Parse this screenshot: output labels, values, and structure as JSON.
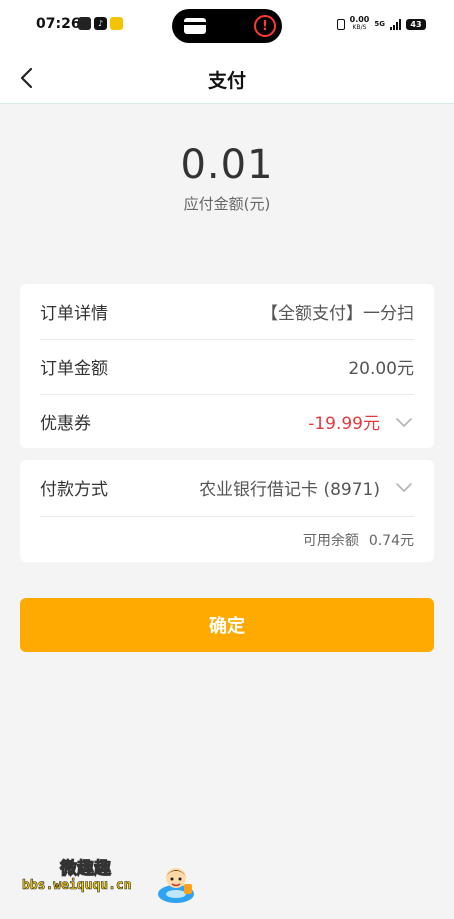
{
  "status_bar": {
    "time": "07:26",
    "net_speed": "0.00",
    "net_unit": "KB/S",
    "network": "5G",
    "battery": "43"
  },
  "nav": {
    "title": "支付",
    "back_icon": "chevron-left-icon"
  },
  "amount": {
    "value": "0.01",
    "label": "应付金额(元)"
  },
  "order": {
    "details_label": "订单详情",
    "details_value": "【全额支付】一分扫",
    "amount_label": "订单金额",
    "amount_value": "20.00元",
    "coupon_label": "优惠券",
    "coupon_value": "-19.99元"
  },
  "payment": {
    "method_label": "付款方式",
    "method_value": "农业银行借记卡 (8971)",
    "balance_label": "可用余额",
    "balance_value": "0.74元"
  },
  "confirm_label": "确定",
  "watermark": {
    "title": "微趣趣",
    "url": "bbs.weiququ.cn"
  },
  "colors": {
    "accent": "#ffaa00",
    "discount": "#e4393c",
    "background": "#f4f4f5"
  }
}
